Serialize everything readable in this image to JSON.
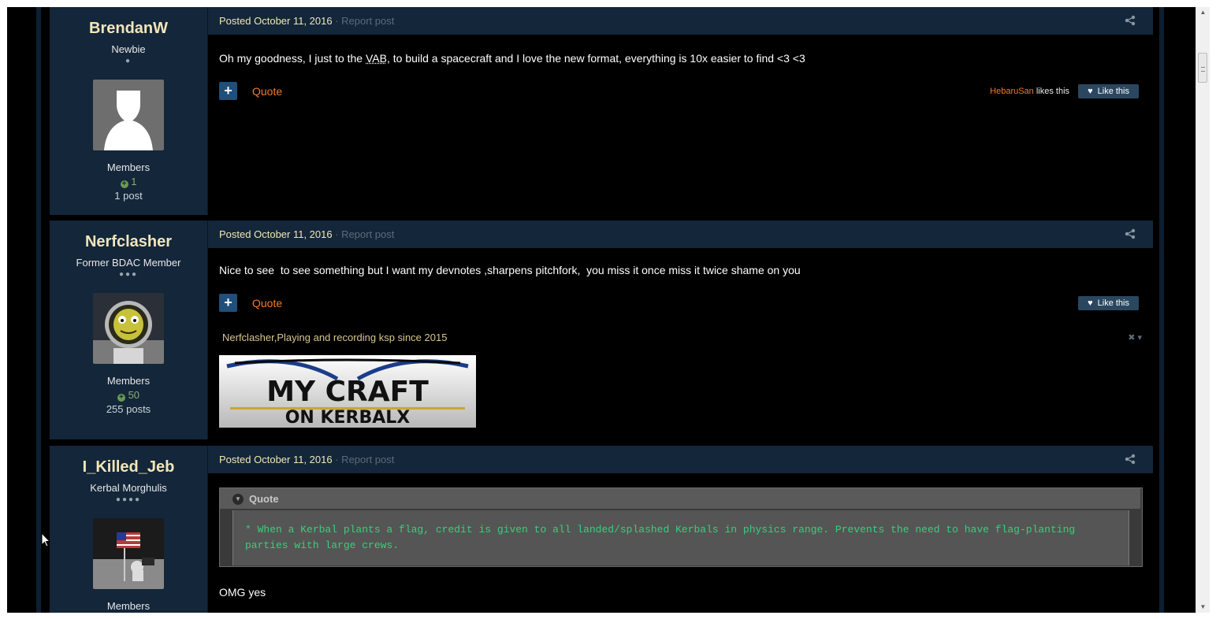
{
  "posts": [
    {
      "author": {
        "name": "BrendanW",
        "title": "Newbie",
        "pips": "●",
        "avatar_icon": "default-avatar-silhouette",
        "group": "Members",
        "reputation": "1",
        "post_count": "1 post"
      },
      "posted_label": "Posted",
      "date": "October 11, 2016",
      "report": "· Report post",
      "body_pre": "Oh my goodness, I just to the ",
      "body_abbr": "VAB",
      "body_post": ", to build a spacecraft and I love the new format, everything is 10x easier to find <3 <3",
      "quote_label": "Quote",
      "liker": "HebaruSan",
      "likes_this": "likes this",
      "like_label": "Like this"
    },
    {
      "author": {
        "name": "Nerfclasher",
        "title": "Former BDAC Member",
        "pips": "●●●",
        "avatar_icon": "kerbal-helmet-avatar",
        "group": "Members",
        "reputation": "50",
        "post_count": "255 posts"
      },
      "posted_label": "Posted",
      "date": "October 11, 2016",
      "report": "· Report post",
      "body": "Nice to see  to see something but I want my devnotes ,sharpens pitchfork,  you miss it once miss it twice shame on you",
      "quote_label": "Quote",
      "like_label": "Like this",
      "signature": "Nerfclasher,Playing and recording ksp since 2015",
      "signature_controls": "✖ ▾",
      "banner_line1": "MY CRAFT",
      "banner_line2": "ON KERBALX"
    },
    {
      "author": {
        "name": "I_Killed_Jeb",
        "title": "Kerbal Morghulis",
        "pips": "●●●●",
        "avatar_icon": "moon-flag-avatar",
        "group": "Members"
      },
      "posted_label": "Posted",
      "date": "October 11, 2016",
      "report": "· Report post",
      "quote_title": "Quote",
      "quote_text": "* When a Kerbal plants a flag, credit is given to all landed/splashed Kerbals in physics range.  Prevents the need to have flag-planting parties with large crews.",
      "body": "OMG yes"
    }
  ],
  "colors": {
    "author_panel": "#13263a",
    "author_name": "#f2e6b8",
    "link_orange": "#f07a2a",
    "quote_green": "#37d07a",
    "report_grey": "#5d6b78"
  }
}
